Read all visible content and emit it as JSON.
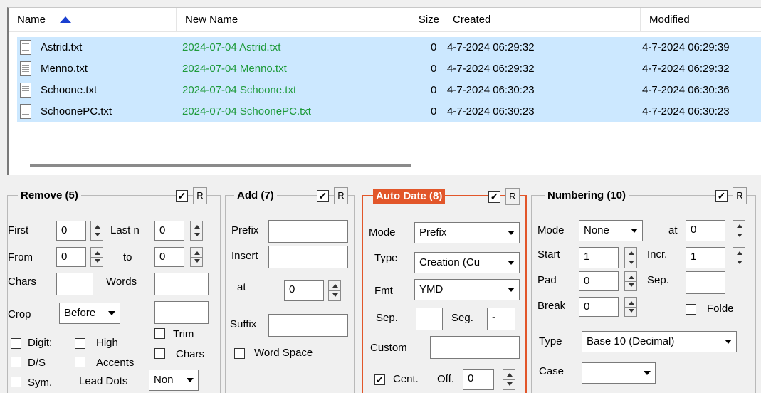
{
  "file_list": {
    "columns": {
      "name": "Name",
      "new_name": "New Name",
      "size": "Size",
      "created": "Created",
      "modified": "Modified"
    },
    "rows": [
      {
        "name": "Astrid.txt",
        "new_name": "2024-07-04 Astrid.txt",
        "size": "0",
        "created": "4-7-2024 06:29:32",
        "modified": "4-7-2024 06:29:39"
      },
      {
        "name": "Menno.txt",
        "new_name": "2024-07-04 Menno.txt",
        "size": "0",
        "created": "4-7-2024 06:29:32",
        "modified": "4-7-2024 06:29:32"
      },
      {
        "name": "Schoone.txt",
        "new_name": "2024-07-04 Schoone.txt",
        "size": "0",
        "created": "4-7-2024 06:30:23",
        "modified": "4-7-2024 06:30:36"
      },
      {
        "name": "SchoonePC.txt",
        "new_name": "2024-07-04 SchoonePC.txt",
        "size": "0",
        "created": "4-7-2024 06:30:23",
        "modified": "4-7-2024 06:30:23"
      }
    ]
  },
  "remove": {
    "title": "Remove (5)",
    "r": "R",
    "first_label": "First",
    "first_value": "0",
    "last_n_label": "Last n",
    "last_n_value": "0",
    "from_label": "From",
    "from_value": "0",
    "to_label": "to",
    "to_value": "0",
    "chars_label": "Chars",
    "chars_value": "",
    "words_label": "Words",
    "words_value": "",
    "crop_label": "Crop",
    "crop_value": "Before",
    "crop_text": "",
    "digits_label": "Digit:",
    "high_label": "High",
    "trim_label": "Trim",
    "ds_label": "D/S",
    "accents_label": "Accents",
    "chars2_label": "Chars",
    "sym_label": "Sym.",
    "lead_dots_label": "Lead Dots",
    "lead_dots_value": "Non"
  },
  "add": {
    "title": "Add (7)",
    "r": "R",
    "prefix_label": "Prefix",
    "prefix_value": "",
    "insert_label": "Insert",
    "insert_value": "",
    "at_label": "at",
    "at_value": "0",
    "suffix_label": "Suffix",
    "suffix_value": "",
    "word_space_label": "Word Space"
  },
  "auto_date": {
    "title": "Auto Date (8)",
    "r": "R",
    "mode_label": "Mode",
    "mode_value": "Prefix",
    "type_label": "Type",
    "type_value": "Creation (Cu",
    "fmt_label": "Fmt",
    "fmt_value": "YMD",
    "sep_label": "Sep.",
    "sep_value": "",
    "seg_label": "Seg.",
    "seg_value": "-",
    "custom_label": "Custom",
    "custom_value": "",
    "cent_label": "Cent.",
    "off_label": "Off.",
    "off_value": "0"
  },
  "numbering": {
    "title": "Numbering (10)",
    "r": "R",
    "mode_label": "Mode",
    "mode_value": "None",
    "at_label": "at",
    "at_value": "0",
    "start_label": "Start",
    "start_value": "1",
    "incr_label": "Incr.",
    "incr_value": "1",
    "pad_label": "Pad",
    "pad_value": "0",
    "sep_label": "Sep.",
    "sep_value": "",
    "break_label": "Break",
    "break_value": "0",
    "folder_label": "Folde",
    "type_label": "Type",
    "type_value": "Base 10 (Decimal)",
    "case_label": "Case",
    "case_value": ""
  },
  "colors": {
    "selection": "#cce8ff",
    "new_name": "#1e9a3a",
    "active_panel": "#e2562a",
    "sort_arrow": "#1a3fd0"
  }
}
